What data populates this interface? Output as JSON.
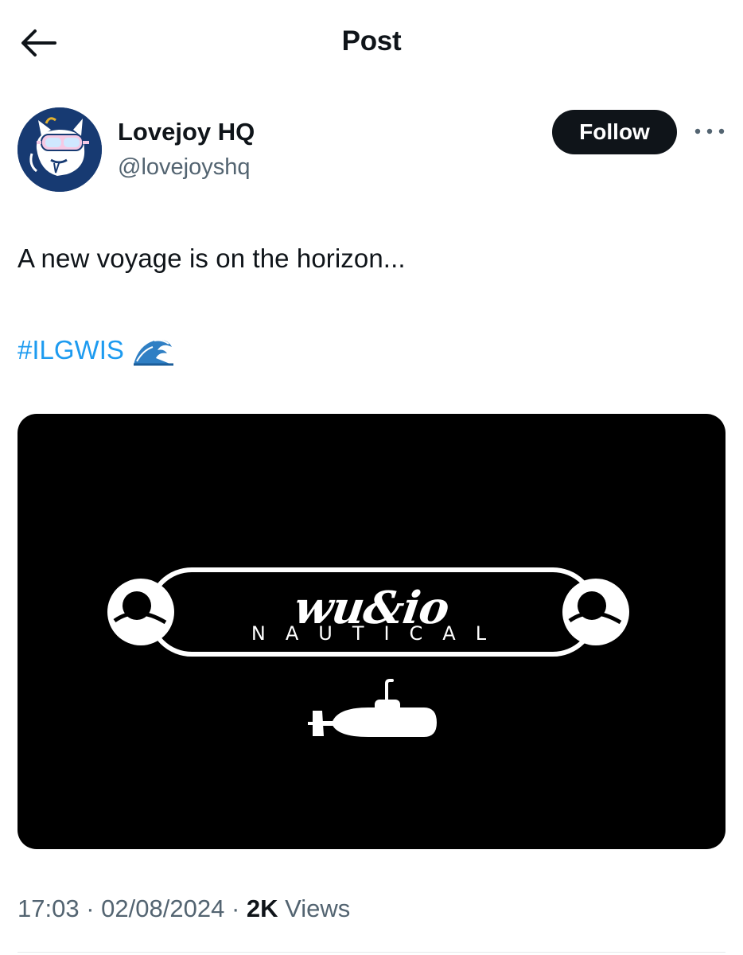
{
  "header": {
    "title": "Post"
  },
  "author": {
    "name": "Lovejoy HQ",
    "handle": "@lovejoyshq",
    "follow_label": "Follow",
    "avatar_bg": "#173a72"
  },
  "tweet": {
    "text": "A new voyage is on the horizon...",
    "hashtag": "#ILGWIS",
    "emoji_icon": "water-wave-icon",
    "hashtag_color": "#1d9bf0"
  },
  "media": {
    "logo_wordmark": "wu&io",
    "logo_subtitle": "NAUTICAL",
    "background": "#000000"
  },
  "meta": {
    "time": "17:03",
    "date": "02/08/2024",
    "separator": "·",
    "views_count": "2K",
    "views_label": "Views"
  }
}
